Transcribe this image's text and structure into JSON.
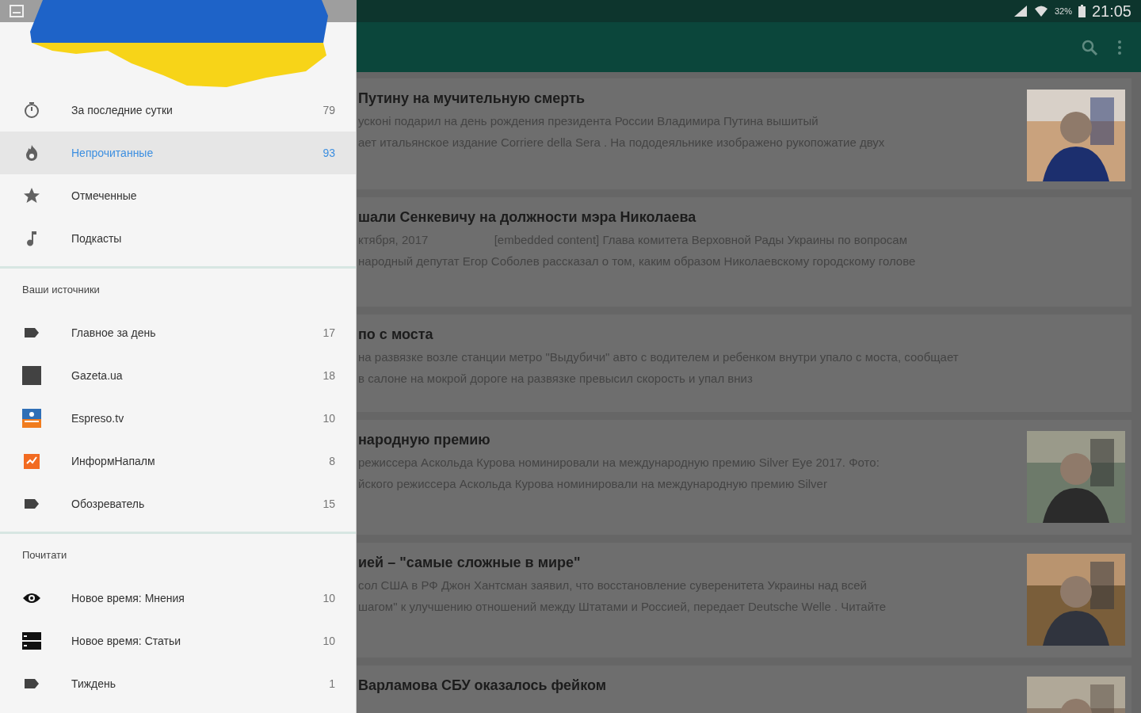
{
  "status_bar": {
    "battery": "32%",
    "time": "21:05"
  },
  "drawer": {
    "top_items": [
      {
        "label": "За последние сутки",
        "count": "79",
        "selected": false
      },
      {
        "label": "Непрочитанные",
        "count": "93",
        "selected": true
      },
      {
        "label": "Отмеченные",
        "selected": false
      },
      {
        "label": "Подкасты",
        "selected": false
      }
    ],
    "sections": [
      {
        "title": "Ваши источники",
        "items": [
          {
            "label": "Главное за день",
            "count": "17",
            "selected": false
          },
          {
            "label": "Gazeta.ua",
            "count": "18",
            "selected": false
          },
          {
            "label": "Espreso.tv",
            "count": "10",
            "selected": false
          },
          {
            "label": "ИнформНапалм",
            "count": "8",
            "selected": false
          },
          {
            "label": "Обозреватель",
            "count": "15",
            "selected": false
          }
        ]
      },
      {
        "title": "Почитати",
        "items": [
          {
            "label": "Новое время: Мнения",
            "count": "10",
            "selected": false
          },
          {
            "label": "Новое время: Статьи",
            "count": "10",
            "selected": false
          },
          {
            "label": "Тиждень",
            "count": "1",
            "selected": false
          }
        ]
      }
    ]
  },
  "articles": [
    {
      "title": "Путину на мучительную смерть",
      "lines": [
        "усконі подарил на день рождения президента России Владимира Путина вышитый",
        "ает итальянское издание Corriere della Sera . На пододеяльнике изображено рукопожатие двух"
      ],
      "has_image": true
    },
    {
      "title": "шали Сенкевичу на должности мэра Николаева",
      "lines": [
        "ктября, 2017                    [embedded content] Глава комитета Верховной Рады Украины по вопросам",
        "народный депутат Егор Соболев рассказал о том, каким образом Николаевскому городскому голове"
      ],
      "has_image": false
    },
    {
      "title": "по с моста",
      "lines": [
        "на развязке возле станции метро \"Выдубичи\" авто с водителем и ребенком внутри упало с моста, сообщает",
        "в салоне на мокрой дороге на развязке превысил скорость и упал вниз"
      ],
      "has_image": false
    },
    {
      "title": "народную премию",
      "lines": [
        "режиссера Аскольда Курова номинировали на международную премию Silver Eye 2017. Фото:",
        "йского режиссера Аскольда Курова номинировали на международную премию Silver"
      ],
      "has_image": true
    },
    {
      "title": "ией – \"самые сложные в мире\"",
      "lines": [
        "сол США в РФ Джон Хантсман заявил, что восстановление суверенитета Украины над всей",
        "шагом\" к улучшению отношений между Штатами и Россией, передает Deutsche Welle . Читайте"
      ],
      "has_image": true
    },
    {
      "title": "Варламова СБУ оказалось фейком",
      "has_image": true
    }
  ]
}
